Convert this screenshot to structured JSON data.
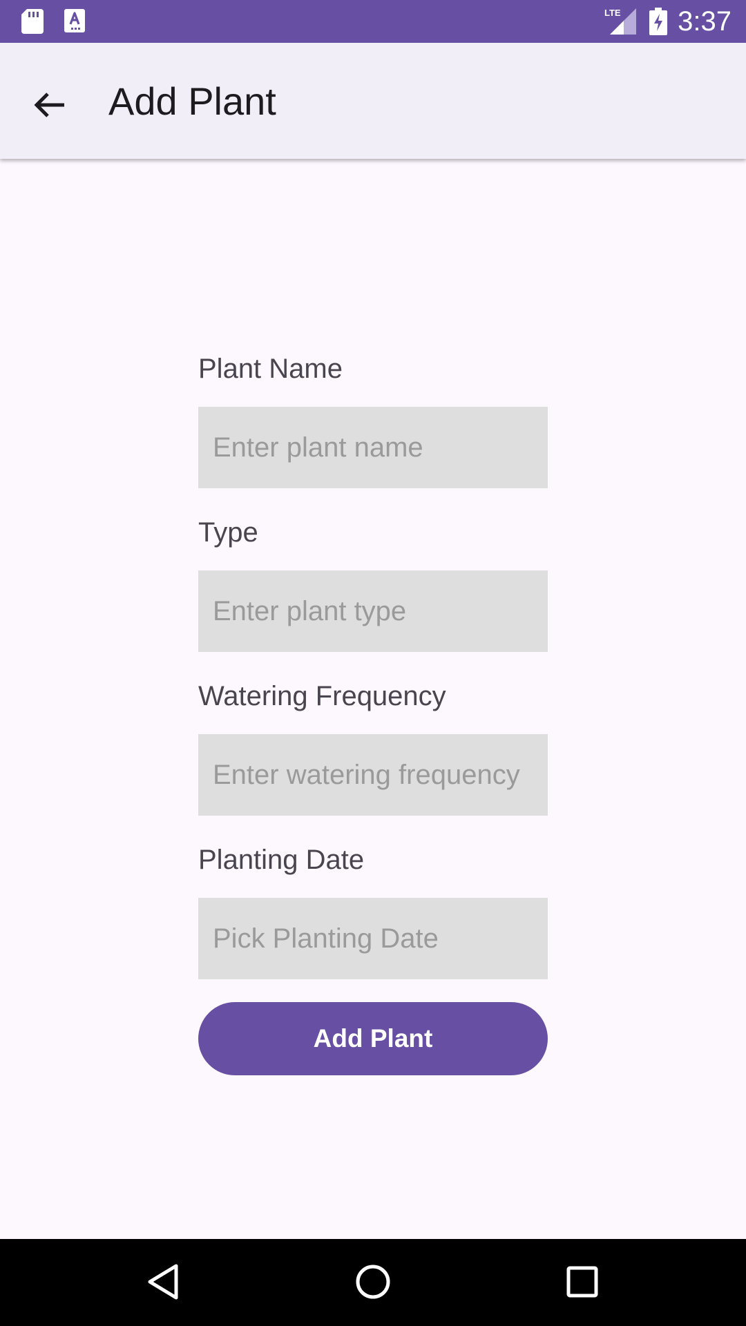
{
  "status_bar": {
    "time": "3:37",
    "network_label": "LTE",
    "icons": [
      "sd-card-icon",
      "keyboard-a-icon",
      "lte-signal-icon",
      "battery-charging-icon"
    ]
  },
  "app_bar": {
    "title": "Add Plant",
    "back_icon": "arrow-back-icon"
  },
  "form": {
    "plant_name": {
      "label": "Plant Name",
      "value": "",
      "placeholder": "Enter plant name"
    },
    "type": {
      "label": "Type",
      "value": "",
      "placeholder": "Enter plant type"
    },
    "watering_frequency": {
      "label": "Watering Frequency",
      "value": "",
      "placeholder": "Enter watering frequency"
    },
    "planting_date": {
      "label": "Planting Date",
      "value": "",
      "placeholder": "Pick Planting Date"
    },
    "submit_label": "Add Plant"
  },
  "nav_bar": {
    "icons": [
      "nav-back-icon",
      "nav-home-icon",
      "nav-recents-icon"
    ]
  },
  "colors": {
    "primary": "#6750A4",
    "app_bar_bg": "#F2EEF7",
    "page_bg": "#FDF7FE",
    "input_bg": "#DEDEDE",
    "placeholder": "#9A9A9A"
  }
}
